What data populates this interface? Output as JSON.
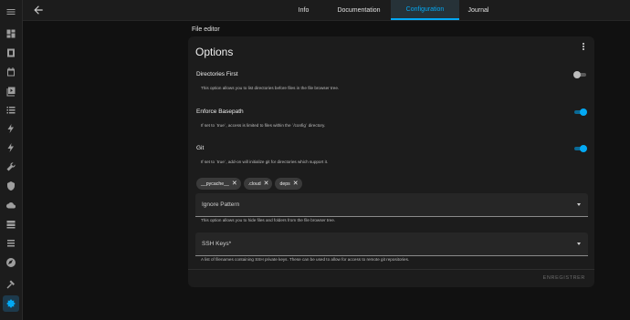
{
  "tabs": [
    {
      "label": "Info"
    },
    {
      "label": "Documentation"
    },
    {
      "label": "Configuration"
    },
    {
      "label": "Journal"
    }
  ],
  "section_title": "File editor",
  "card": {
    "title": "Options",
    "options": [
      {
        "title": "Directories First",
        "description": "This option allows you to list directories before files in the file browser tree.",
        "enabled": false
      },
      {
        "title": "Enforce Basepath",
        "description": "If set to `true`, access is limited to files within the `/config` directory.",
        "enabled": true
      },
      {
        "title": "Git",
        "description": "If set to `true`, add-on will initialize git for directories which support it.",
        "enabled": true
      }
    ],
    "chips": [
      {
        "label": "__pycache__"
      },
      {
        "label": ".cloud"
      },
      {
        "label": "deps"
      }
    ],
    "ignore_pattern": {
      "label": "Ignore Pattern",
      "help": "This option allows you to hide files and folders from the file browser tree."
    },
    "ssh_keys": {
      "label": "SSH Keys*",
      "help": "A list of filenames containing SSH private keys. These can be used to allow for access to remote git repositories."
    },
    "save_label": "ENREGISTRER"
  },
  "sidebar_icons": [
    "dashboard-icon",
    "energy-icon",
    "calendar-icon",
    "media-icon",
    "logbook-icon",
    "lightning-icon",
    "lightning-icon",
    "wrench-icon",
    "shield-icon",
    "cloud-icon",
    "server-icon",
    "list-icon",
    "compass-icon",
    "hammer-icon",
    "settings-icon"
  ],
  "colors": {
    "accent": "#03a9f4",
    "background": "#111111",
    "card": "#1c1c1c"
  }
}
